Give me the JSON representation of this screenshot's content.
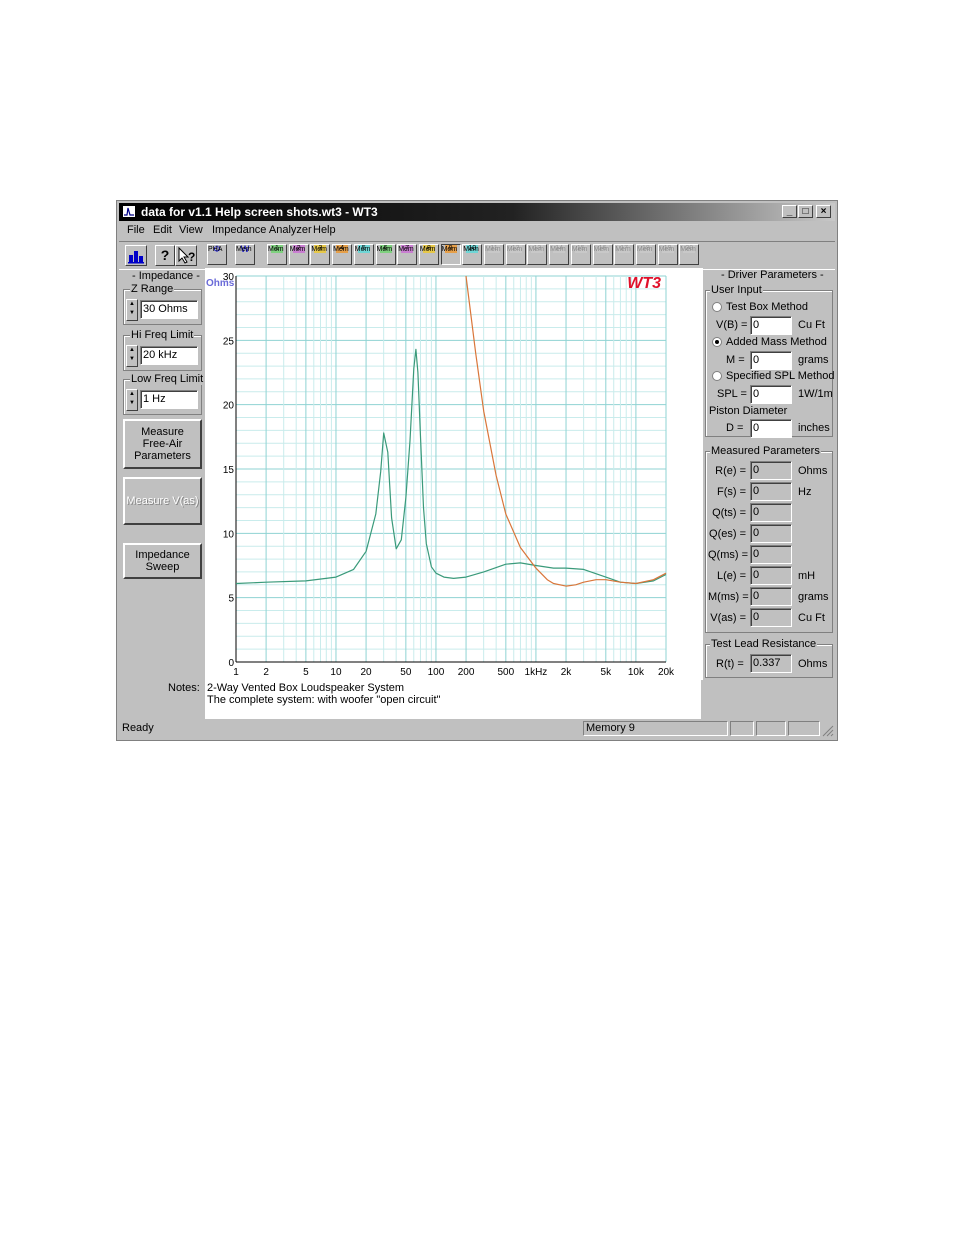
{
  "window": {
    "title": "data for v1.1 Help screen shots.wt3 - WT3",
    "controls": [
      "_",
      "□",
      "×"
    ]
  },
  "menu": [
    "File",
    "Edit",
    "View",
    "Impedance Analyzer",
    "Help"
  ],
  "toolbar": {
    "pha": {
      "label": "PHA",
      "sub": "Φ"
    },
    "memw": {
      "label": "Mem",
      "sub": "W"
    },
    "memories": [
      {
        "label": "Mem",
        "num": "1",
        "color": "#7fd17f",
        "enabled": true
      },
      {
        "label": "Mem",
        "num": "2",
        "color": "#c97fd1",
        "enabled": true
      },
      {
        "label": "Mem",
        "num": "3",
        "color": "#e6c84a",
        "enabled": true
      },
      {
        "label": "Mem",
        "num": "4",
        "color": "#e6a04a",
        "enabled": true
      },
      {
        "label": "Mem",
        "num": "5",
        "color": "#6fd6d6",
        "enabled": true
      },
      {
        "label": "Mem",
        "num": "6",
        "color": "#7fd17f",
        "enabled": true
      },
      {
        "label": "Mem",
        "num": "7",
        "color": "#c97fd1",
        "enabled": true
      },
      {
        "label": "Mem",
        "num": "8",
        "color": "#e6c84a",
        "enabled": true
      },
      {
        "label": "Mem",
        "num": "9",
        "color": "#e6a04a",
        "enabled": true
      },
      {
        "label": "Mem",
        "num": "10",
        "color": "#6fd6d6",
        "enabled": true
      },
      {
        "label": "Mem",
        "num": "11",
        "color": "#c8c8c8",
        "enabled": false
      },
      {
        "label": "Mem",
        "num": "12",
        "color": "#c8c8c8",
        "enabled": false
      },
      {
        "label": "Mem",
        "num": "13",
        "color": "#c8c8c8",
        "enabled": false
      },
      {
        "label": "Mem",
        "num": "14",
        "color": "#c8c8c8",
        "enabled": false
      },
      {
        "label": "Mem",
        "num": "15",
        "color": "#c8c8c8",
        "enabled": false
      },
      {
        "label": "Mem",
        "num": "16",
        "color": "#c8c8c8",
        "enabled": false
      },
      {
        "label": "Mem",
        "num": "17",
        "color": "#c8c8c8",
        "enabled": false
      },
      {
        "label": "Mem",
        "num": "18",
        "color": "#c8c8c8",
        "enabled": false
      },
      {
        "label": "Mem",
        "num": "19",
        "color": "#c8c8c8",
        "enabled": false
      },
      {
        "label": "Mem",
        "num": "20",
        "color": "#c8c8c8",
        "enabled": false
      }
    ]
  },
  "left": {
    "impedance_title": "- Impedance -",
    "z_range": {
      "label": "Z Range",
      "value": "30 Ohms"
    },
    "hi_freq": {
      "label": "Hi Freq Limit",
      "value": "20 kHz"
    },
    "low_freq": {
      "label": "Low Freq Limit",
      "value": "1 Hz"
    },
    "measure_free_air": "Measure Free-Air Parameters",
    "measure_vas": "Measure V(as)",
    "impedance_sweep": "Impedance Sweep"
  },
  "chart_data": {
    "type": "line",
    "brand": "WT3",
    "ylabel": "Ohms",
    "yticks": [
      "0",
      "5",
      "10",
      "15",
      "20",
      "25",
      "30"
    ],
    "ylim": [
      0,
      30
    ],
    "xscale": "log",
    "xlim": [
      1,
      20000
    ],
    "xticks": [
      {
        "v": 1,
        "t": "1"
      },
      {
        "v": 2,
        "t": "2"
      },
      {
        "v": 5,
        "t": "5"
      },
      {
        "v": 10,
        "t": "10"
      },
      {
        "v": 20,
        "t": "20"
      },
      {
        "v": 50,
        "t": "50"
      },
      {
        "v": 100,
        "t": "100"
      },
      {
        "v": 200,
        "t": "200"
      },
      {
        "v": 500,
        "t": "500"
      },
      {
        "v": 1000,
        "t": "1kHz"
      },
      {
        "v": 2000,
        "t": "2k"
      },
      {
        "v": 5000,
        "t": "5k"
      },
      {
        "v": 10000,
        "t": "10k"
      },
      {
        "v": 20000,
        "t": "20k"
      }
    ],
    "grid": true,
    "series": [
      {
        "color": "#3a9a7a",
        "x": [
          1,
          2,
          5,
          10,
          15,
          20,
          25,
          28,
          30,
          33,
          36,
          40,
          45,
          50,
          55,
          60,
          63,
          66,
          70,
          75,
          80,
          90,
          100,
          120,
          150,
          200,
          300,
          500,
          700,
          1000,
          1500,
          2000,
          3000,
          5000,
          7000,
          10000,
          15000,
          20000
        ],
        "y": [
          6.1,
          6.2,
          6.3,
          6.6,
          7.2,
          8.6,
          11.5,
          14.8,
          17.8,
          16.3,
          11.2,
          8.8,
          9.5,
          12.8,
          17.2,
          22.8,
          24.3,
          22.5,
          17.5,
          12.0,
          9.2,
          7.4,
          6.9,
          6.6,
          6.5,
          6.6,
          7.0,
          7.6,
          7.7,
          7.5,
          7.3,
          7.3,
          7.2,
          6.6,
          6.2,
          6.1,
          6.3,
          6.8
        ]
      },
      {
        "color": "#d9763a",
        "x": [
          200,
          250,
          300,
          400,
          500,
          700,
          1000,
          1300,
          1500,
          2000,
          2500,
          3000,
          4000,
          5000,
          7000,
          10000,
          15000,
          20000
        ],
        "y": [
          30,
          24,
          19.5,
          14.5,
          11.5,
          8.9,
          7.3,
          6.4,
          6.1,
          5.9,
          6.0,
          6.2,
          6.4,
          6.4,
          6.2,
          6.1,
          6.4,
          6.9
        ]
      }
    ]
  },
  "notes": {
    "label": "Notes:",
    "line1": "2-Way Vented Box Loudspeaker System",
    "line2": "The complete system: with woofer \"open circuit\""
  },
  "right": {
    "title": "- Driver Parameters -",
    "user_input": "User Input",
    "test_box": "Test Box Method",
    "vb_label": "V(B) =",
    "vb_value": "0",
    "vb_unit": "Cu Ft",
    "added_mass": "Added Mass Method",
    "m_label": "M =",
    "m_value": "0",
    "m_unit": "grams",
    "spl_method": "Specified SPL Method",
    "spl_label": "SPL =",
    "spl_value": "0",
    "spl_unit": "1W/1m",
    "piston": "Piston Diameter",
    "d_label": "D =",
    "d_value": "0",
    "d_unit": "inches",
    "measured": "Measured Parameters",
    "params": [
      {
        "label": "R(e) =",
        "value": "0",
        "unit": "Ohms"
      },
      {
        "label": "F(s) =",
        "value": "0",
        "unit": "Hz"
      },
      {
        "label": "Q(ts) =",
        "value": "0",
        "unit": ""
      },
      {
        "label": "Q(es) =",
        "value": "0",
        "unit": ""
      },
      {
        "label": "Q(ms) =",
        "value": "0",
        "unit": ""
      },
      {
        "label": "L(e) =",
        "value": "0",
        "unit": "mH"
      },
      {
        "label": "M(ms) =",
        "value": "0",
        "unit": "grams"
      },
      {
        "label": "V(as) =",
        "value": "0",
        "unit": "Cu Ft"
      }
    ],
    "test_lead": "Test Lead Resistance",
    "rt_label": "R(t) =",
    "rt_value": "0.337",
    "rt_unit": "Ohms"
  },
  "status": {
    "ready": "Ready",
    "memory": "Memory 9"
  }
}
